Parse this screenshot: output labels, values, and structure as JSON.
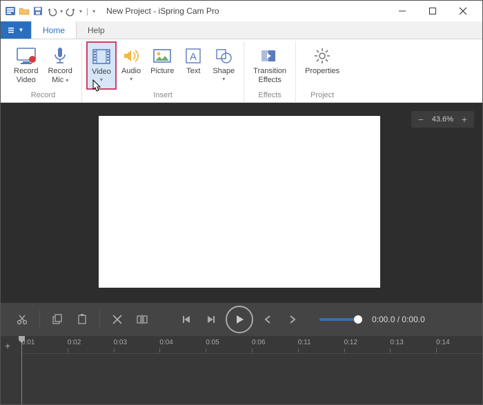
{
  "window": {
    "title": "New Project - iSpring Cam Pro"
  },
  "tabs": {
    "file_label": "",
    "home": "Home",
    "help": "Help"
  },
  "ribbon": {
    "record": {
      "label": "Record",
      "record_video_l1": "Record",
      "record_video_l2": "Video",
      "record_mic_l1": "Record",
      "record_mic_l2": "Mic"
    },
    "insert": {
      "label": "Insert",
      "video": "Video",
      "audio": "Audio",
      "picture": "Picture",
      "text": "Text",
      "shape": "Shape"
    },
    "effects": {
      "label": "Effects",
      "transition_l1": "Transition",
      "transition_l2": "Effects"
    },
    "project": {
      "label": "Project",
      "properties": "Properties"
    }
  },
  "zoom": {
    "value": "43.6%"
  },
  "transport": {
    "time_current": "0:00.0",
    "time_total": "0:00.0"
  },
  "timeline": {
    "ticks": [
      "0:01",
      "0:02",
      "0:03",
      "0:04",
      "0:05",
      "0:06",
      "0:11",
      "0:12",
      "0:13",
      "0:14"
    ]
  }
}
